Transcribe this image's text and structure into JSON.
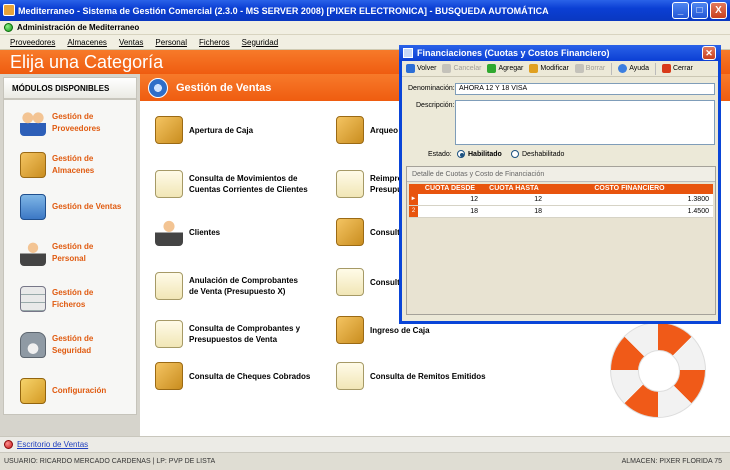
{
  "window": {
    "title": "Mediterraneo - Sistema de Gestión Comercial (2.3.0 - MS SERVER 2008) [PIXER ELECTRONICA] - BUSQUEDA AUTOMÁTICA",
    "buttons": [
      "_",
      "□",
      "X"
    ]
  },
  "subtitle": "Administración de Mediterraneo",
  "menu": [
    "Proveedores",
    "Almacenes",
    "Ventas",
    "Personal",
    "Ficheros",
    "Seguridad"
  ],
  "banner": "Elija una Categoría",
  "sidebar": {
    "header": "MÓDULOS DISPONIBLES",
    "items": [
      {
        "label": "Gestión de Proveedores",
        "icon": "suppliers-icon"
      },
      {
        "label": "Gestión de Almacenes",
        "icon": "warehouse-icon"
      },
      {
        "label": "Gestión de Ventas",
        "icon": "cash-register-icon"
      },
      {
        "label": "Gestión de Personal",
        "icon": "person-icon"
      },
      {
        "label": "Gestión de Ficheros",
        "icon": "cabinet-icon"
      },
      {
        "label": "Gestión de Seguridad",
        "icon": "lock-icon"
      },
      {
        "label": "Configuración",
        "icon": "config-icon"
      }
    ]
  },
  "main": {
    "title": "Gestión de Ventas",
    "options": [
      {
        "label": "Apertura de Caja",
        "icon": "cash-box-icon"
      },
      {
        "label": "Arqueo y",
        "icon": "cash-box-icon"
      },
      {
        "label": "Consulta de Movimientos de Cuentas Corrientes de Clientes",
        "icon": "search-doc-icon"
      },
      {
        "label": "Reimpres Presupue",
        "icon": "document-icon"
      },
      {
        "label": "Clientes",
        "icon": "client-icon"
      },
      {
        "label": "Consulta",
        "icon": "cash-box-icon"
      },
      {
        "label": "Anulación de Comprobantes de Venta (Presupuesto X)",
        "icon": "cancel-doc-icon"
      },
      {
        "label": "Consulta",
        "icon": "search-doc-icon"
      },
      {
        "label": "Consulta de Comprobantes y Presupuestos de Venta",
        "icon": "search-doc-icon"
      },
      {
        "label": "Ingreso de Caja",
        "icon": "cash-in-icon"
      },
      {
        "label": "Consulta de Cheques Cobrados",
        "icon": "cash-box-icon"
      },
      {
        "label": "Consulta de Remitos Emitidos",
        "icon": "search-doc-icon"
      }
    ]
  },
  "statusbar": {
    "escritorio": "Escritorio de Ventas",
    "user": "USUARIO: RICARDO MERCADO CARDENAS  |  LP: PVP DE LISTA",
    "almacen": "ALMACEN: PIXER FLORIDA 75"
  },
  "dialog": {
    "title": "Financiaciones (Cuotas y Costos Financiero)",
    "toolbar": [
      {
        "label": "Volver",
        "icon": "back-icon",
        "color": "#2b6ed6",
        "enabled": true
      },
      {
        "label": "Cancelar",
        "icon": "cancel-icon",
        "color": "#a0a0a0",
        "enabled": false
      },
      {
        "label": "Agregar",
        "icon": "add-icon",
        "color": "#2fa82f",
        "enabled": true
      },
      {
        "label": "Modificar",
        "icon": "edit-icon",
        "color": "#e0a020",
        "enabled": true
      },
      {
        "label": "Borrar",
        "icon": "delete-icon",
        "color": "#a0a0a0",
        "enabled": false
      },
      {
        "label": "Ayuda",
        "icon": "help-icon",
        "color": "#3b7ee0",
        "enabled": true
      },
      {
        "label": "Cerrar",
        "icon": "close-icon",
        "color": "#d83a1a",
        "enabled": true
      }
    ],
    "denominacion_label": "Denominación:",
    "denominacion_value": "AHORA 12  Y  18 VISA",
    "descripcion_label": "Descripción:",
    "descripcion_value": "",
    "estado_label": "Estado:",
    "estado_options": [
      "Habilitado",
      "Deshabilitado"
    ],
    "estado_selected": "Habilitado",
    "grid_caption": "Detalle de Cuotas y Costo de Financiación",
    "columns": [
      "CUOTA DESDE",
      "CUOTA HASTA",
      "COSTO FINANCIERO"
    ],
    "rows": [
      {
        "marker": "►",
        "desde": "12",
        "hasta": "12",
        "costo": "1.3800"
      },
      {
        "marker": "2",
        "desde": "18",
        "hasta": "18",
        "costo": "1.4500"
      }
    ]
  }
}
